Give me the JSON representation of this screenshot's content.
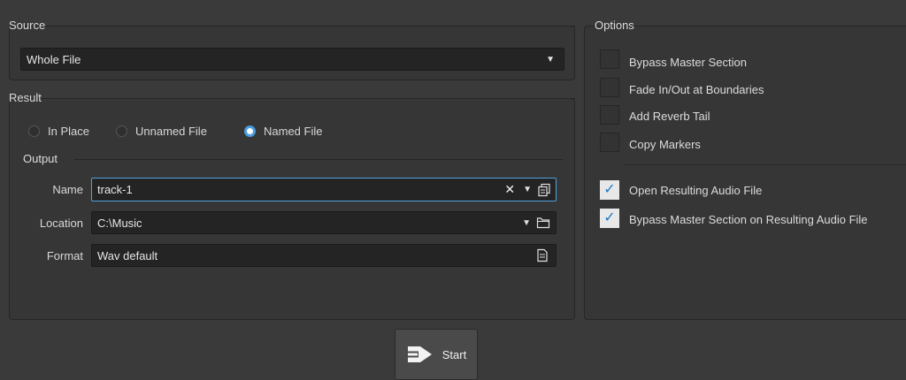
{
  "source": {
    "legend": "Source",
    "selected": "Whole File"
  },
  "result": {
    "legend": "Result",
    "modes": [
      {
        "label": "In Place",
        "selected": false
      },
      {
        "label": "Unnamed File",
        "selected": false
      },
      {
        "label": "Named File",
        "selected": true
      }
    ]
  },
  "output": {
    "legend": "Output",
    "name_label": "Name",
    "name_value": "track-1",
    "location_label": "Location",
    "location_value": "C:\\Music",
    "format_label": "Format",
    "format_value": "Wav default"
  },
  "options": {
    "legend": "Options",
    "items": [
      {
        "label": "Bypass Master Section",
        "checked": false
      },
      {
        "label": "Fade In/Out at Boundaries",
        "checked": false
      },
      {
        "label": "Add Reverb Tail",
        "checked": false
      },
      {
        "label": "Copy Markers",
        "checked": false
      },
      {
        "label": "Open Resulting Audio File",
        "checked": true
      },
      {
        "label": "Bypass Master Section on Resulting Audio File",
        "checked": true
      }
    ]
  },
  "actions": {
    "start_label": "Start"
  },
  "colors": {
    "background": "#3a3a3a",
    "accent": "#4a9de0",
    "field_bg": "#242424"
  }
}
